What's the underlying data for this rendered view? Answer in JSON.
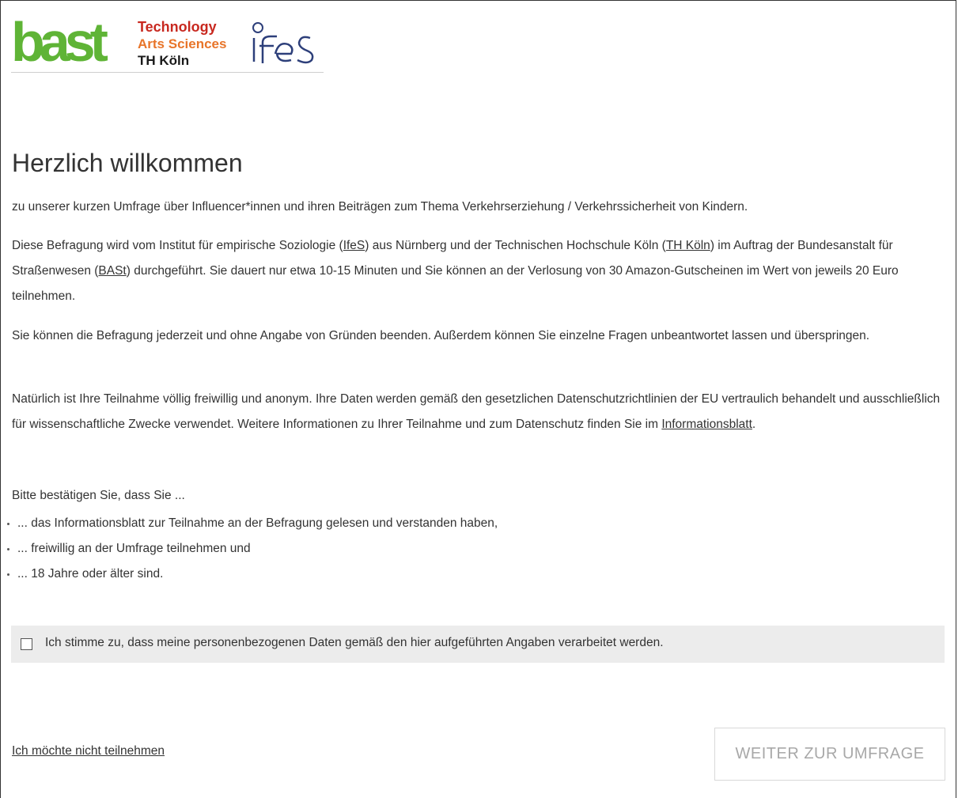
{
  "logos": {
    "bast": "bast",
    "th_koeln": [
      "Technology",
      "Arts Sciences",
      "TH Köln"
    ],
    "ifes": "ifes",
    "colors": {
      "bast_green": "#5fb436",
      "th_red": "#c8281f",
      "th_orange": "#e8752a",
      "th_magenta": "#b5338a",
      "ifes_blue": "#2d3f7a"
    }
  },
  "page": {
    "title": "Herzlich willkommen",
    "intro": "zu unserer kurzen Umfrage über Influencer*innen und ihren Beiträgen zum Thema Verkehrserziehung / Verkehrssicherheit von Kindern.",
    "para2": {
      "t1": "Diese Befragung wird vom Institut für empirische Soziologie (",
      "link1": "IfeS",
      "t2": ") aus Nürnberg und der Technischen Hochschule Köln (",
      "link2": "TH Köln",
      "t3": ") im Auftrag der Bundesanstalt für Straßenwesen (",
      "link3": "BASt",
      "t4": ") durchgeführt. Sie dauert nur etwa 10-15 Minuten und Sie können an der Verlosung von 30 Amazon-Gutscheinen im Wert von jeweils 20 Euro teilnehmen."
    },
    "para3": "Sie können die Befragung jederzeit und ohne Angabe von Gründen beenden. Außerdem können Sie einzelne Fragen unbeantwortet lassen und überspringen.",
    "para4": {
      "t1": "Natürlich ist Ihre Teilnahme völlig freiwillig und anonym. Ihre Daten werden gemäß den gesetzlichen Datenschutzrichtlinien der EU vertraulich behandelt und ausschließlich für wissenschaftliche Zwecke verwendet. Weitere Informationen zu Ihrer Teilnahme und zum Datenschutz finden Sie im ",
      "link": "Informationsblatt",
      "t2": "."
    },
    "confirm_intro": "Bitte bestätigen Sie, dass Sie ...",
    "bullets": [
      "... das Informationsblatt zur Teilnahme an der Befragung gelesen und verstanden haben,",
      "... freiwillig an der Umfrage teilnehmen und",
      "... 18 Jahre oder älter sind."
    ],
    "consent_label": "Ich stimme zu, dass meine personenbezogenen Daten gemäß den hier aufgeführten Angaben verarbeitet werden.",
    "consent_checked": false,
    "decline_link": "Ich möchte nicht teilnehmen",
    "next_button": "WEITER ZUR UMFRAGE"
  }
}
